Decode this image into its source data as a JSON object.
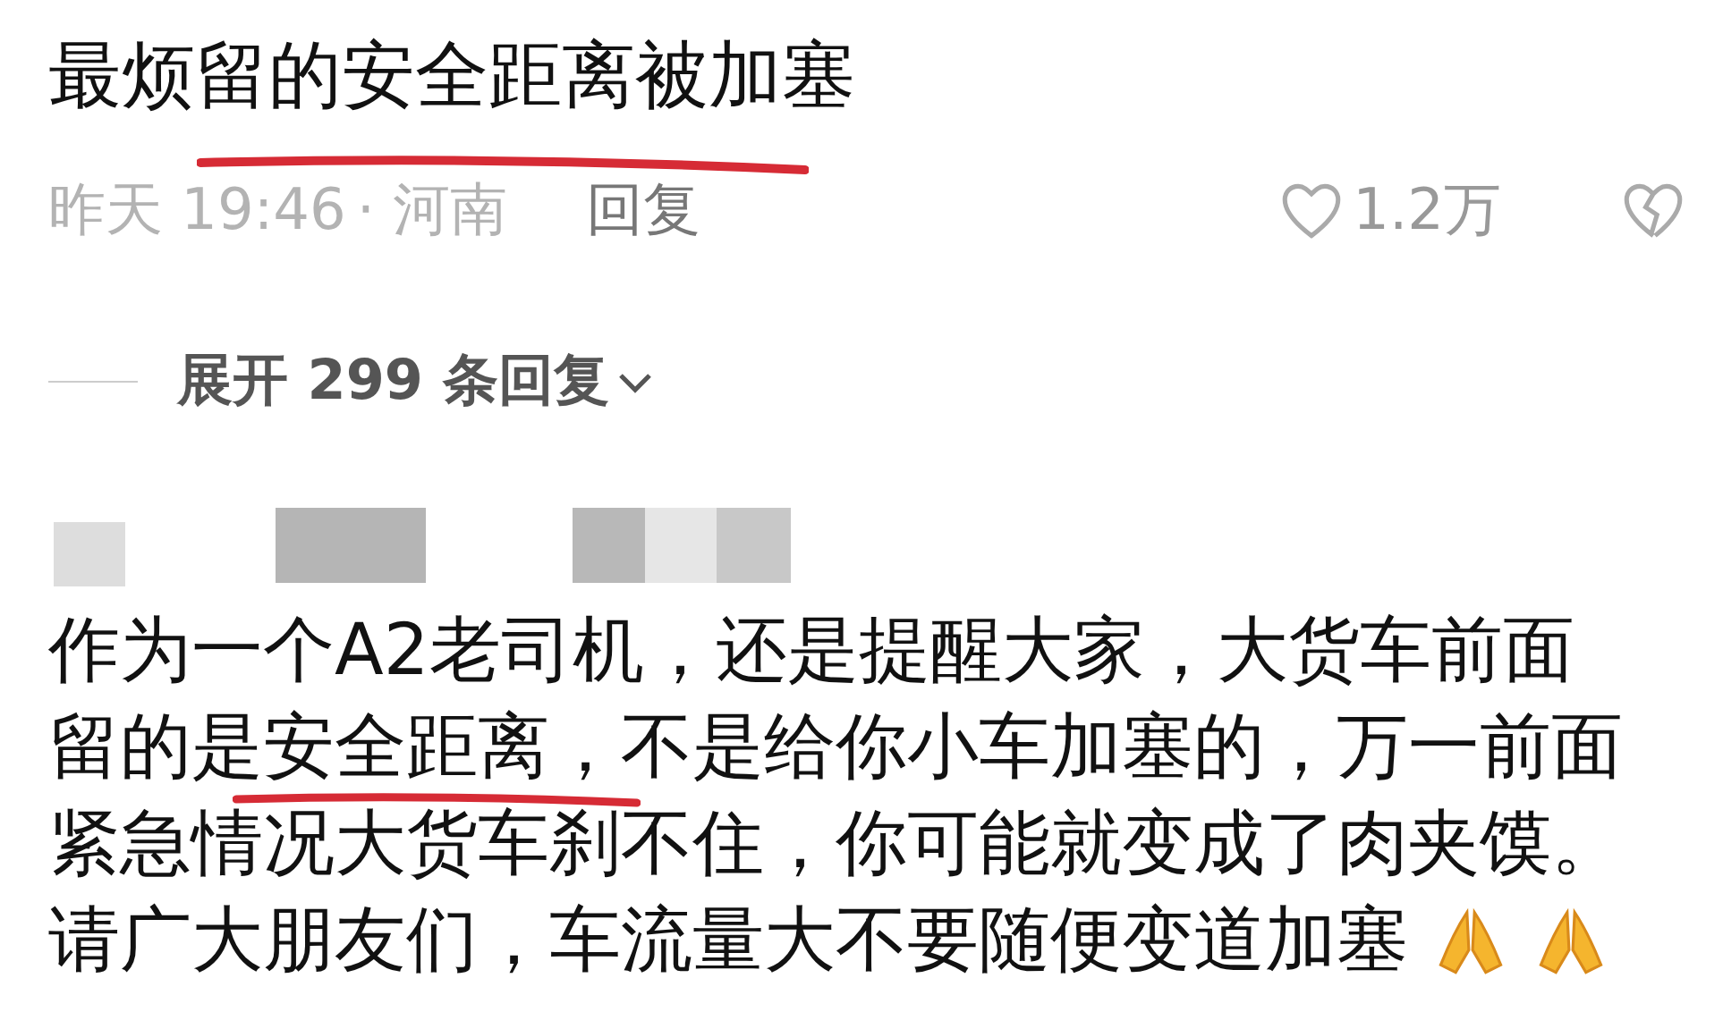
{
  "comment": {
    "text": "最烦留的安全距离被加塞",
    "time": "昨天 19:46",
    "location": "· 河南",
    "reply": "回复",
    "likes": "1.2万"
  },
  "expand": {
    "label": "展开 299 条回复"
  },
  "reply": {
    "lines": [
      "作为一个A2老司机，还是提醒大家，大货车前面",
      "留的是安全距离，不是给你小车加塞的，万一前面",
      "紧急情况大货车刹不住，你可能就变成了肉夹馍。",
      "请广大朋友们，车流量大不要随便变道加塞"
    ]
  }
}
